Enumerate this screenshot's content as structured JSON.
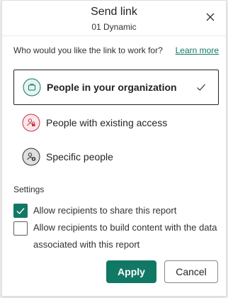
{
  "dialog": {
    "title": "Send link",
    "subtitle": "01 Dynamic",
    "close_icon": "close-icon"
  },
  "question": {
    "text": "Who would you like the link to work for?",
    "learn_more": "Learn more"
  },
  "options": [
    {
      "label": "People in your organization",
      "icon": "briefcase-icon",
      "selected": true,
      "accent": "#117865"
    },
    {
      "label": "People with existing access",
      "icon": "people-lock-icon",
      "selected": false,
      "accent": "#c4314b"
    },
    {
      "label": "Specific people",
      "icon": "person-add-icon",
      "selected": false,
      "accent": "#323130"
    }
  ],
  "settings": {
    "label": "Settings",
    "checkboxes": [
      {
        "label": "Allow recipients to share this report",
        "checked": true
      },
      {
        "label": "Allow recipients to build content with the data associated with this report",
        "checked": false
      }
    ]
  },
  "buttons": {
    "apply": "Apply",
    "cancel": "Cancel"
  },
  "colors": {
    "accent": "#117865",
    "danger": "#c4314b"
  }
}
